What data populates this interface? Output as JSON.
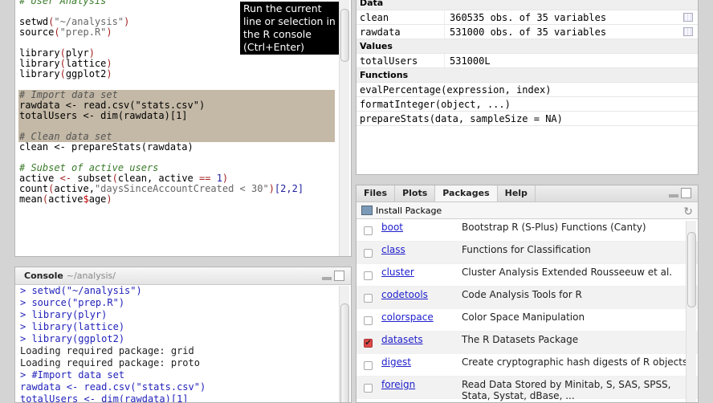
{
  "editor": {
    "lines": [
      [
        {
          "t": "# User Analysis",
          "c": "cm"
        }
      ],
      [],
      [
        {
          "t": "setwd"
        },
        {
          "t": "(",
          "c": "pn"
        },
        {
          "t": "\"~/analysis\"",
          "c": "st"
        },
        {
          "t": ")",
          "c": "pn"
        }
      ],
      [
        {
          "t": "source"
        },
        {
          "t": "(",
          "c": "pn"
        },
        {
          "t": "\"prep.R\"",
          "c": "st"
        },
        {
          "t": ")",
          "c": "pn"
        }
      ],
      [],
      [
        {
          "t": "library"
        },
        {
          "t": "(",
          "c": "pn"
        },
        {
          "t": "plyr"
        },
        {
          "t": ")",
          "c": "pn"
        }
      ],
      [
        {
          "t": "library"
        },
        {
          "t": "(",
          "c": "pn"
        },
        {
          "t": "lattice"
        },
        {
          "t": ")",
          "c": "pn"
        }
      ],
      [
        {
          "t": "library"
        },
        {
          "t": "(",
          "c": "pn"
        },
        {
          "t": "ggplot2"
        },
        {
          "t": ")",
          "c": "pn"
        }
      ],
      [],
      [
        {
          "t": "# Import data set",
          "c": "cm"
        }
      ],
      [
        {
          "t": "rawdata <- read.csv(\"stats.csv\")"
        }
      ],
      [
        {
          "t": "totalUsers <- dim(rawdata)[1]"
        }
      ],
      [],
      [
        {
          "t": "# Clean data set",
          "c": "cm"
        }
      ],
      [
        {
          "t": "clean <- prepareStats(rawdata)"
        }
      ],
      [],
      [
        {
          "t": "# Subset of active users",
          "c": "cm"
        }
      ],
      [
        {
          "t": "active "
        },
        {
          "t": "<-",
          "c": "op"
        },
        {
          "t": " subset"
        },
        {
          "t": "(",
          "c": "pn"
        },
        {
          "t": "clean, active "
        },
        {
          "t": "==",
          "c": "op"
        },
        {
          "t": " "
        },
        {
          "t": "1",
          "c": "nm"
        },
        {
          "t": ")",
          "c": "pn"
        }
      ],
      [
        {
          "t": "count"
        },
        {
          "t": "(",
          "c": "pn"
        },
        {
          "t": "active,"
        },
        {
          "t": "\"daysSinceAccountCreated < 30\"",
          "c": "st"
        },
        {
          "t": ")",
          "c": "pn"
        },
        {
          "t": "[2,2]",
          "c": "nm"
        }
      ],
      [
        {
          "t": "mean"
        },
        {
          "t": "(",
          "c": "pn"
        },
        {
          "t": "active"
        },
        {
          "t": "$",
          "c": "dl"
        },
        {
          "t": "age"
        },
        {
          "t": ")",
          "c": "pn"
        }
      ]
    ],
    "highlight": [
      9,
      10,
      11,
      12,
      13
    ],
    "tooltip": "Run the current line or selection in the R console (Ctrl+Enter)"
  },
  "console": {
    "title": "Console",
    "path": "~/analysis/",
    "lines": [
      {
        "t": "> setwd(\"~/analysis\")",
        "k": "in"
      },
      {
        "t": "> source(\"prep.R\")",
        "k": "in"
      },
      {
        "t": "> library(plyr)",
        "k": "in"
      },
      {
        "t": "> library(lattice)",
        "k": "in"
      },
      {
        "t": "> library(ggplot2)",
        "k": "in"
      },
      {
        "t": "Loading required package: grid",
        "k": "out"
      },
      {
        "t": "Loading required package: proto",
        "k": "out"
      },
      {
        "t": "> #Import data set",
        "k": "in"
      },
      {
        "t": "rawdata <- read.csv(\"stats.csv\")",
        "k": "in"
      },
      {
        "t": "totalUsers <- dim(rawdata)[1]",
        "k": "in"
      }
    ]
  },
  "environment": {
    "sections": [
      {
        "title": "Data",
        "rows": [
          {
            "name": "clean",
            "value": "360535 obs. of 35 variables",
            "grid": true
          },
          {
            "name": "rawdata",
            "value": "531000 obs. of 35 variables",
            "grid": true
          }
        ]
      },
      {
        "title": "Values",
        "rows": [
          {
            "name": "totalUsers",
            "value": "531000L"
          }
        ]
      },
      {
        "title": "Functions",
        "rows": [
          {
            "name": "evalPercentage(expression, index)"
          },
          {
            "name": "formatInteger(object, ...)"
          },
          {
            "name": "prepareStats(data, sampleSize = NA)"
          }
        ]
      }
    ]
  },
  "packages_pane": {
    "tabs": [
      "Files",
      "Plots",
      "Packages",
      "Help"
    ],
    "active_tab": "Packages",
    "install_label": "Install Package",
    "packages": [
      {
        "name": "boot",
        "desc": "Bootstrap R (S-Plus) Functions (Canty)",
        "loaded": false
      },
      {
        "name": "class",
        "desc": "Functions for Classification",
        "loaded": false
      },
      {
        "name": "cluster",
        "desc": "Cluster Analysis Extended Rousseeuw et al.",
        "loaded": false
      },
      {
        "name": "codetools",
        "desc": "Code Analysis Tools for R",
        "loaded": false
      },
      {
        "name": "colorspace",
        "desc": "Color Space Manipulation",
        "loaded": false
      },
      {
        "name": "datasets",
        "desc": "The R Datasets Package",
        "loaded": true
      },
      {
        "name": "digest",
        "desc": "Create cryptographic hash digests of R objects",
        "loaded": false
      },
      {
        "name": "foreign",
        "desc": "Read Data Stored by Minitab, S, SAS, SPSS, Stata, Systat, dBase, ...",
        "loaded": false
      }
    ]
  }
}
